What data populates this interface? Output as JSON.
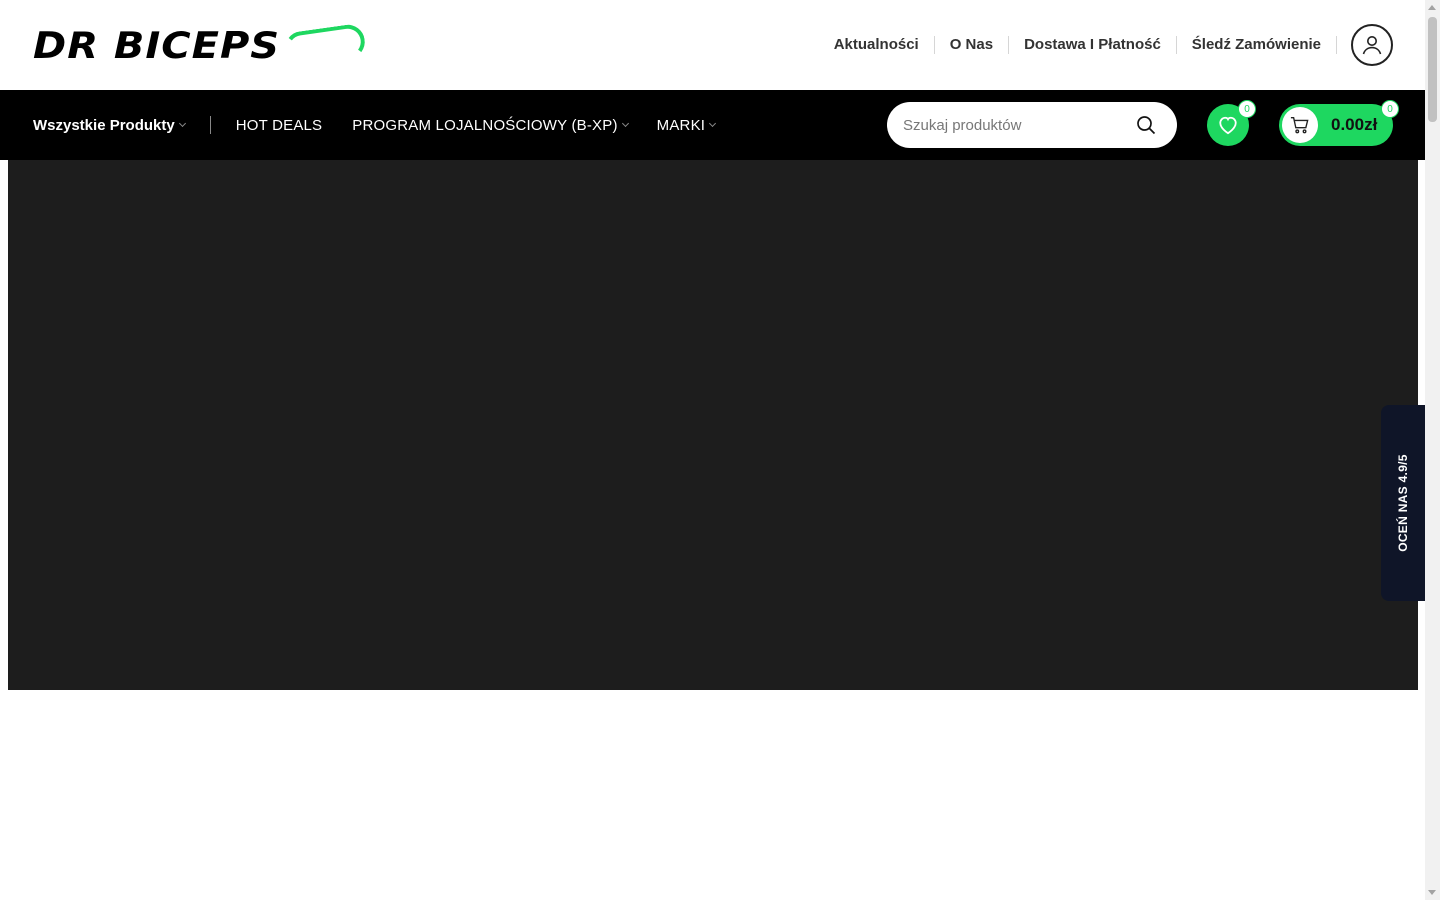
{
  "brand": {
    "logo_text": "DR BICEPS",
    "accent_color": "#1ed760"
  },
  "top_nav": {
    "links": [
      "Aktualności",
      "O Nas",
      "Dostawa I Płatność",
      "Śledź Zamówienie"
    ]
  },
  "main_nav": {
    "all_products": "Wszystkie Produkty",
    "hot_deals": "HOT DEALS",
    "loyalty": "PROGRAM LOJALNOŚCIOWY (B-XP)",
    "brands": "MARKI"
  },
  "search": {
    "placeholder": "Szukaj produktów"
  },
  "wishlist": {
    "count": "0",
    "icon": "heart-icon"
  },
  "cart": {
    "count": "0",
    "total": "0.00zł",
    "icon": "cart-icon"
  },
  "review_tab": {
    "label": "OCEŃ NAS 4.9/5"
  },
  "colors": {
    "hero_bg": "#1d1d1d",
    "review_tab_bg": "#0f1528",
    "bar_bg": "#000000"
  }
}
